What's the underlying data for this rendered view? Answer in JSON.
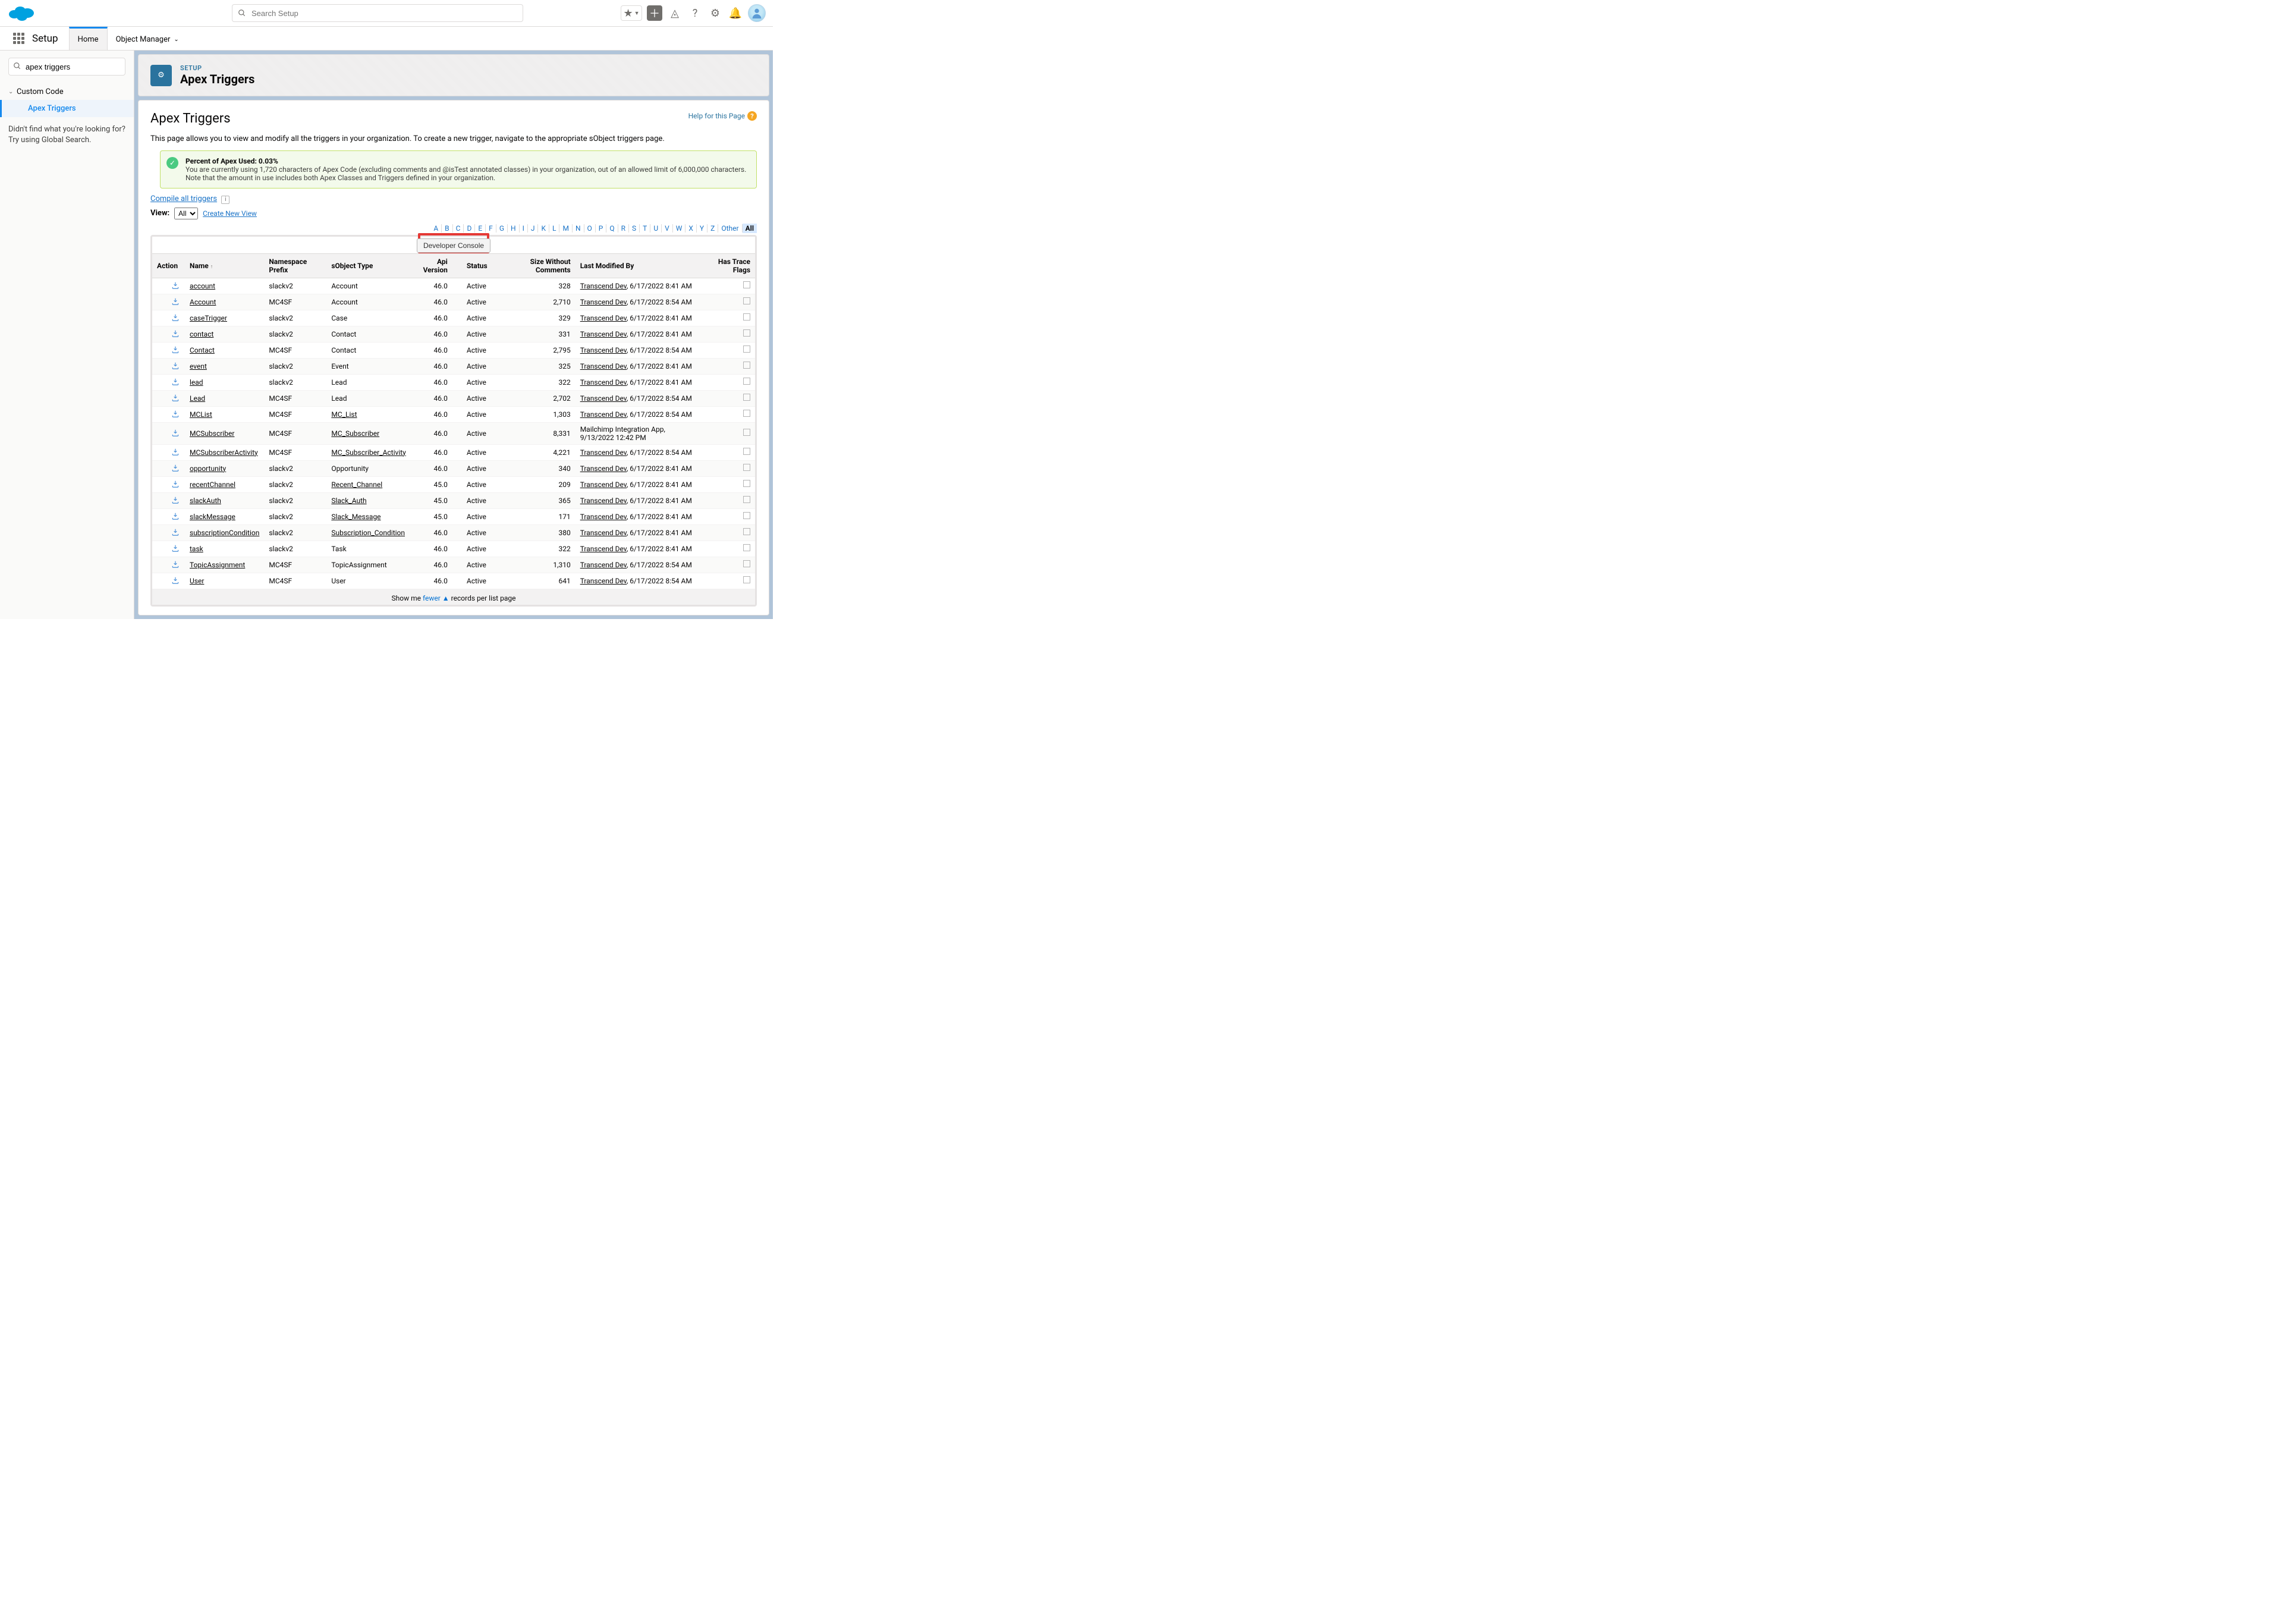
{
  "header": {
    "search_placeholder": "Search Setup"
  },
  "context": {
    "app_name": "Setup",
    "tab_home": "Home",
    "tab_object_manager": "Object Manager"
  },
  "sidebar": {
    "search_value": "apex triggers",
    "section": "Custom Code",
    "item": "Apex Triggers",
    "help1": "Didn't find what you're looking for?",
    "help2": "Try using Global Search."
  },
  "pageheader": {
    "label": "SETUP",
    "title": "Apex Triggers"
  },
  "card": {
    "title": "Apex Triggers",
    "help": "Help for this Page",
    "desc": "This page allows you to view and modify all the triggers in your organization. To create a new trigger, navigate to the appropriate sObject triggers page.",
    "info_title": "Percent of Apex Used: 0.03%",
    "info_body": "You are currently using 1,720 characters of Apex Code (excluding comments and @isTest annotated classes) in your organization, out of an allowed limit of 6,000,000 characters. Note that the amount in use includes both Apex Classes and Triggers defined in your organization.",
    "compile": "Compile all triggers",
    "view_label": "View:",
    "view_value": "All",
    "create_view": "Create New View"
  },
  "alpha": {
    "letters": [
      "A",
      "B",
      "C",
      "D",
      "E",
      "F",
      "G",
      "H",
      "I",
      "J",
      "K",
      "L",
      "M",
      "N",
      "O",
      "P",
      "Q",
      "R",
      "S",
      "T",
      "U",
      "V",
      "W",
      "X",
      "Y",
      "Z"
    ],
    "other": "Other",
    "all": "All"
  },
  "dev_console": "Developer Console",
  "columns": {
    "action": "Action",
    "name": "Name",
    "ns": "Namespace Prefix",
    "sobj": "sObject Type",
    "api": "Api Version",
    "status": "Status",
    "size": "Size Without Comments",
    "lmb": "Last Modified By",
    "trace": "Has Trace Flags"
  },
  "rows": [
    {
      "name": "account",
      "ns": "slackv2",
      "sobj": "Account",
      "sobj_link": false,
      "api": "46.0",
      "status": "Active",
      "size": "328",
      "by": "Transcend Dev",
      "date": "6/17/2022 8:41 AM"
    },
    {
      "name": "Account",
      "ns": "MC4SF",
      "sobj": "Account",
      "sobj_link": false,
      "api": "46.0",
      "status": "Active",
      "size": "2,710",
      "by": "Transcend Dev",
      "date": "6/17/2022 8:54 AM"
    },
    {
      "name": "caseTrigger",
      "ns": "slackv2",
      "sobj": "Case",
      "sobj_link": false,
      "api": "46.0",
      "status": "Active",
      "size": "329",
      "by": "Transcend Dev",
      "date": "6/17/2022 8:41 AM"
    },
    {
      "name": "contact",
      "ns": "slackv2",
      "sobj": "Contact",
      "sobj_link": false,
      "api": "46.0",
      "status": "Active",
      "size": "331",
      "by": "Transcend Dev",
      "date": "6/17/2022 8:41 AM"
    },
    {
      "name": "Contact",
      "ns": "MC4SF",
      "sobj": "Contact",
      "sobj_link": false,
      "api": "46.0",
      "status": "Active",
      "size": "2,795",
      "by": "Transcend Dev",
      "date": "6/17/2022 8:54 AM"
    },
    {
      "name": "event",
      "ns": "slackv2",
      "sobj": "Event",
      "sobj_link": false,
      "api": "46.0",
      "status": "Active",
      "size": "325",
      "by": "Transcend Dev",
      "date": "6/17/2022 8:41 AM"
    },
    {
      "name": "lead",
      "ns": "slackv2",
      "sobj": "Lead",
      "sobj_link": false,
      "api": "46.0",
      "status": "Active",
      "size": "322",
      "by": "Transcend Dev",
      "date": "6/17/2022 8:41 AM"
    },
    {
      "name": "Lead",
      "ns": "MC4SF",
      "sobj": "Lead",
      "sobj_link": false,
      "api": "46.0",
      "status": "Active",
      "size": "2,702",
      "by": "Transcend Dev",
      "date": "6/17/2022 8:54 AM"
    },
    {
      "name": "MCList",
      "ns": "MC4SF",
      "sobj": "MC_List",
      "sobj_link": true,
      "api": "46.0",
      "status": "Active",
      "size": "1,303",
      "by": "Transcend Dev",
      "date": "6/17/2022 8:54 AM"
    },
    {
      "name": "MCSubscriber",
      "ns": "MC4SF",
      "sobj": "MC_Subscriber",
      "sobj_link": true,
      "api": "46.0",
      "status": "Active",
      "size": "8,331",
      "by": "Mailchimp Integration App",
      "date": "9/13/2022 12:42 PM"
    },
    {
      "name": "MCSubscriberActivity",
      "ns": "MC4SF",
      "sobj": "MC_Subscriber_Activity",
      "sobj_link": true,
      "api": "46.0",
      "status": "Active",
      "size": "4,221",
      "by": "Transcend Dev",
      "date": "6/17/2022 8:54 AM"
    },
    {
      "name": "opportunity",
      "ns": "slackv2",
      "sobj": "Opportunity",
      "sobj_link": false,
      "api": "46.0",
      "status": "Active",
      "size": "340",
      "by": "Transcend Dev",
      "date": "6/17/2022 8:41 AM"
    },
    {
      "name": "recentChannel",
      "ns": "slackv2",
      "sobj": "Recent_Channel",
      "sobj_link": true,
      "api": "45.0",
      "status": "Active",
      "size": "209",
      "by": "Transcend Dev",
      "date": "6/17/2022 8:41 AM"
    },
    {
      "name": "slackAuth",
      "ns": "slackv2",
      "sobj": "Slack_Auth",
      "sobj_link": true,
      "api": "45.0",
      "status": "Active",
      "size": "365",
      "by": "Transcend Dev",
      "date": "6/17/2022 8:41 AM"
    },
    {
      "name": "slackMessage",
      "ns": "slackv2",
      "sobj": "Slack_Message",
      "sobj_link": true,
      "api": "45.0",
      "status": "Active",
      "size": "171",
      "by": "Transcend Dev",
      "date": "6/17/2022 8:41 AM"
    },
    {
      "name": "subscriptionCondition",
      "ns": "slackv2",
      "sobj": "Subscription_Condition",
      "sobj_link": true,
      "api": "46.0",
      "status": "Active",
      "size": "380",
      "by": "Transcend Dev",
      "date": "6/17/2022 8:41 AM"
    },
    {
      "name": "task",
      "ns": "slackv2",
      "sobj": "Task",
      "sobj_link": false,
      "api": "46.0",
      "status": "Active",
      "size": "322",
      "by": "Transcend Dev",
      "date": "6/17/2022 8:41 AM"
    },
    {
      "name": "TopicAssignment",
      "ns": "MC4SF",
      "sobj": "TopicAssignment",
      "sobj_link": false,
      "api": "46.0",
      "status": "Active",
      "size": "1,310",
      "by": "Transcend Dev",
      "date": "6/17/2022 8:54 AM"
    },
    {
      "name": "User",
      "ns": "MC4SF",
      "sobj": "User",
      "sobj_link": false,
      "api": "46.0",
      "status": "Active",
      "size": "641",
      "by": "Transcend Dev",
      "date": "6/17/2022 8:54 AM"
    }
  ],
  "footer": {
    "pre": "Show me ",
    "link": "fewer",
    "post": " records per list page"
  }
}
